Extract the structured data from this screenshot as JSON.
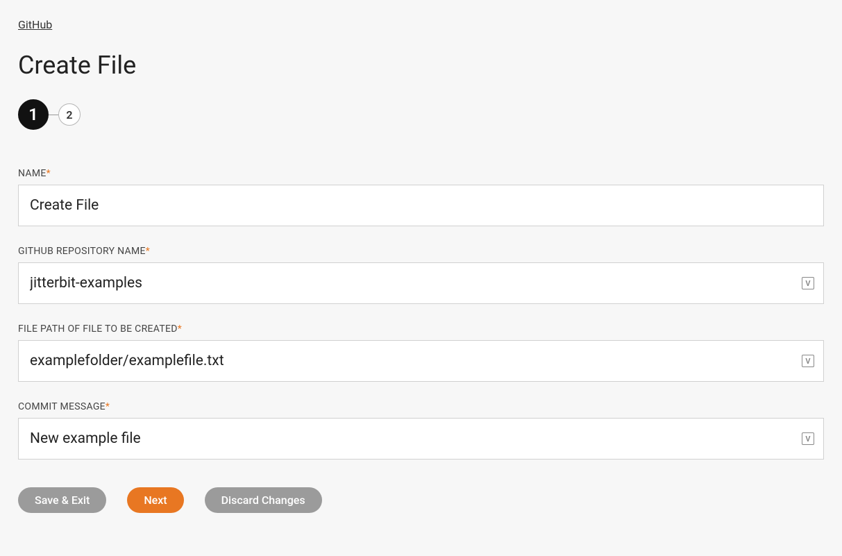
{
  "breadcrumb": {
    "label": "GitHub"
  },
  "page": {
    "title": "Create File"
  },
  "stepper": {
    "step1": "1",
    "step2": "2"
  },
  "fields": {
    "name": {
      "label": "NAME",
      "value": "Create File"
    },
    "repo": {
      "label": "GITHUB REPOSITORY NAME",
      "value": "jitterbit-examples"
    },
    "filepath": {
      "label": "FILE PATH OF FILE TO BE CREATED",
      "value": "examplefolder/examplefile.txt"
    },
    "commit": {
      "label": "COMMIT MESSAGE",
      "value": "New example file"
    }
  },
  "buttons": {
    "saveExit": "Save & Exit",
    "next": "Next",
    "discard": "Discard Changes"
  },
  "varIconLabel": "V"
}
